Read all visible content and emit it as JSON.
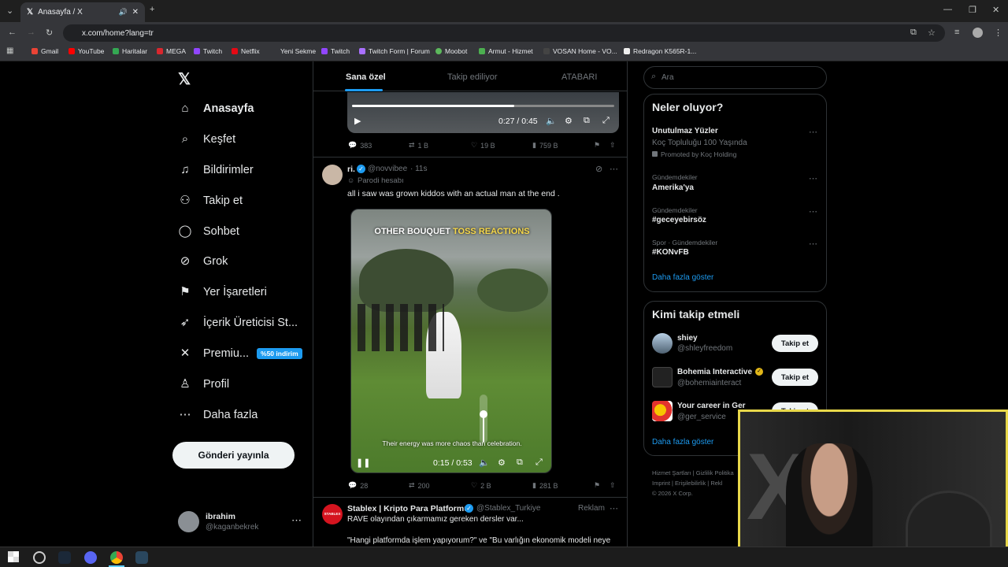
{
  "browser": {
    "tab_title": "Anasayfa / X",
    "url": "x.com/home?lang=tr",
    "bookmarks": [
      "Gmail",
      "YouTube",
      "Haritalar",
      "MEGA",
      "Twitch",
      "Netflix",
      "Yeni Sekme",
      "Twitch",
      "Twitch Form | Forum",
      "Moobot",
      "Armut - Hizmet",
      "VOSAN Home - VO...",
      "Redragon K565R-1..."
    ]
  },
  "nav": {
    "items": [
      "Anasayfa",
      "Keşfet",
      "Bildirimler",
      "Takip et",
      "Sohbet",
      "Grok",
      "Yer İşaretleri",
      "İçerik Üreticisi St...",
      "Premiu...",
      "Profil",
      "Daha fazla"
    ],
    "premium_badge": "%50 indirim",
    "post_button": "Gönderi yayınla",
    "user_name": "ibrahim",
    "user_handle": "@kaganbekrek"
  },
  "timeline": {
    "tabs": [
      "Sana özel",
      "Takip ediliyor",
      "ATABARI"
    ],
    "prev_post": {
      "video_time": "0:27 / 0:45",
      "replies": "383",
      "reposts": "1 B",
      "likes": "19 B",
      "views": "759 B"
    },
    "post": {
      "name": "ri.",
      "handle": "@novvibee",
      "time": "· 11s",
      "parody": "Parodi hesabı",
      "text": "all i saw was grown kiddos with an actual man at the end .",
      "video_title_white": "OTHER BOUQUET ",
      "video_title_yellow": "TOSS REACTIONS",
      "video_caption": "Their energy was more chaos than celebration.",
      "video_time": "0:15 / 0:53",
      "replies": "28",
      "reposts": "200",
      "likes": "2 B",
      "views": "281 B"
    },
    "ad": {
      "name": "Stablex | Kripto Para Platformu",
      "handle": "@Stablex_Turkiye",
      "label": "Reklam",
      "avatar_text": "STABLEX",
      "line1": "RAVE olayından çıkarmamız gereken dersler var...",
      "line2": "\"Hangi platformda işlem yapıyorum?\" ve \"Bu varlığın ekonomik modeli neye"
    }
  },
  "right": {
    "search_placeholder": "Ara",
    "trends_title": "Neler oluyor?",
    "trends": [
      {
        "meta": "",
        "title": "Unutulmaz Yüzler",
        "sub": "Koç Topluluğu 100 Yaşında",
        "promo": "Promoted by Koç Holding"
      },
      {
        "meta": "Gündemdekiler",
        "title": "Amerika'ya"
      },
      {
        "meta": "Gündemdekiler",
        "title": "#geceyebirsöz"
      },
      {
        "meta": "Spor · Gündemdekiler",
        "title": "#KONvFB"
      }
    ],
    "show_more": "Daha fazla göster",
    "who_title": "Kimi takip etmeli",
    "who": [
      {
        "name": "shiey",
        "handle": "@shleyfreedom",
        "button": "Takip et"
      },
      {
        "name": "Bohemia Interactive",
        "handle": "@bohemiainteract",
        "button": "Takip et"
      },
      {
        "name": "Your career in Ger",
        "handle": "@ger_service",
        "button": "Takip et"
      }
    ],
    "who_more": "Daha fazla göster",
    "footer": [
      "Hizmet Şartları",
      "Gizlilik Politika",
      "Imprint",
      "Erişilebilirlik",
      "Rekl",
      "© 2026 X Corp."
    ]
  },
  "colors": {
    "accent": "#1d9bf0",
    "bg": "#000000",
    "border": "#2f3336",
    "muted": "#71767b",
    "webcam_border": "#e8d84a"
  }
}
